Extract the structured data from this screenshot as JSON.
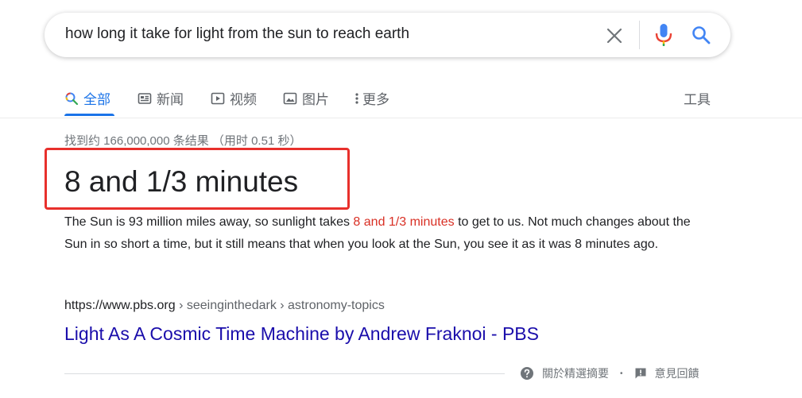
{
  "search": {
    "query": "how long it take for light from the sun to reach earth",
    "icons": [
      "close-icon",
      "mic-icon",
      "search-icon"
    ]
  },
  "tabs": {
    "items": [
      {
        "label": "全部",
        "icon": "search-icon",
        "active": true
      },
      {
        "label": "新闻",
        "icon": "news-icon"
      },
      {
        "label": "视频",
        "icon": "video-icon"
      },
      {
        "label": "图片",
        "icon": "image-icon"
      },
      {
        "label": "更多",
        "icon": "more-vert-icon"
      }
    ],
    "tools": "工具"
  },
  "results": {
    "stats": "找到约 166,000,000 条结果 （用时 0.51 秒）",
    "featured": {
      "answer": "8 and 1/3 minutes",
      "snippet_before": "The Sun is 93 million miles away, so sunlight takes ",
      "snippet_highlight": "8 and 1/3 minutes",
      "snippet_after": " to get to us. Not much changes about the Sun in so short a time, but it still means that when you look at the Sun, you see it as it was 8 minutes ago.",
      "cite_domain": "https://www.pbs.org",
      "cite_path": " › seeinginthedark › astronomy-topics",
      "title": "Light As A Cosmic Time Machine by Andrew Fraknoi - PBS"
    },
    "footer": {
      "about": "關於精選摘要",
      "separator": "•",
      "feedback": "意見回饋"
    }
  },
  "colors": {
    "accent": "#1a73e8",
    "link": "#1a0dab",
    "highlight_text": "#d93025",
    "annotation_box": "#e8302c"
  }
}
